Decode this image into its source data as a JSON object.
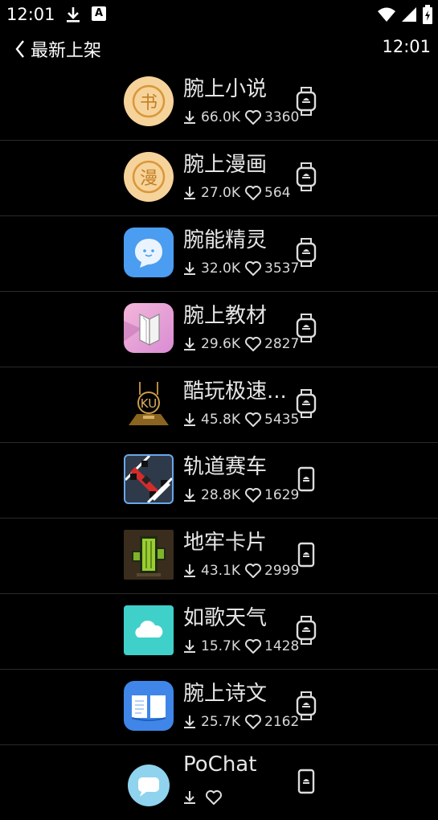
{
  "status_bar": {
    "time": "12:01",
    "notification_letter": "A"
  },
  "header": {
    "title": "最新上架",
    "clock": "12:01"
  },
  "apps": [
    {
      "name": "腕上小说",
      "downloads": "66.0K",
      "likes": "3360",
      "icon": "book-glyph-icon",
      "icon_text": "书",
      "device": "watch"
    },
    {
      "name": "腕上漫画",
      "downloads": "27.0K",
      "likes": "564",
      "icon": "comic-glyph-icon",
      "icon_text": "漫",
      "device": "watch"
    },
    {
      "name": "腕能精灵",
      "downloads": "32.0K",
      "likes": "3537",
      "icon": "chat-bubble-icon",
      "device": "watch"
    },
    {
      "name": "腕上教材",
      "downloads": "29.6K",
      "likes": "2827",
      "icon": "open-book-icon",
      "device": "watch"
    },
    {
      "name": "酷玩极速...",
      "downloads": "45.8K",
      "likes": "5435",
      "icon": "ku-vip-logo-icon",
      "icon_text": "KU",
      "device": "watch"
    },
    {
      "name": "轨道赛车",
      "downloads": "28.8K",
      "likes": "1629",
      "icon": "race-car-icon",
      "device": "band"
    },
    {
      "name": "地牢卡片",
      "downloads": "43.1K",
      "likes": "2999",
      "icon": "pixel-cactus-icon",
      "device": "band"
    },
    {
      "name": "如歌天气",
      "downloads": "15.7K",
      "likes": "1428",
      "icon": "cloud-icon",
      "device": "watch"
    },
    {
      "name": "腕上诗文",
      "downloads": "25.7K",
      "likes": "2162",
      "icon": "poetry-book-icon",
      "device": "watch"
    },
    {
      "name": "PoChat",
      "downloads": "",
      "likes": "",
      "icon": "chat-icon",
      "device": "band"
    }
  ]
}
